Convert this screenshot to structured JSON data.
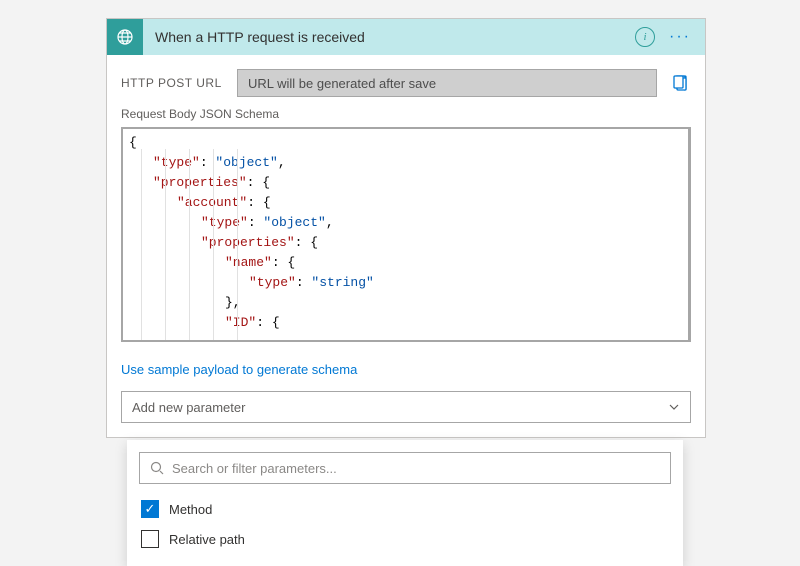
{
  "header": {
    "title": "When a HTTP request is received",
    "info_aria": "Info",
    "menu_aria": "More options"
  },
  "url": {
    "label": "HTTP POST URL",
    "value": "URL will be generated after save",
    "copy_aria": "Copy URL"
  },
  "schema": {
    "label": "Request Body JSON Schema",
    "lines": [
      {
        "indent": 0,
        "open": "{"
      },
      {
        "indent": 1,
        "key": "type",
        "val": "object",
        "comma": true
      },
      {
        "indent": 1,
        "key": "properties",
        "open": "{"
      },
      {
        "indent": 2,
        "key": "account",
        "open": "{"
      },
      {
        "indent": 3,
        "key": "type",
        "val": "object",
        "comma": true
      },
      {
        "indent": 3,
        "key": "properties",
        "open": "{"
      },
      {
        "indent": 4,
        "key": "name",
        "open": "{"
      },
      {
        "indent": 5,
        "key": "type",
        "val": "string"
      },
      {
        "indent": 4,
        "close": "},"
      },
      {
        "indent": 4,
        "key": "ID",
        "open": "{",
        "truncated": true
      }
    ]
  },
  "sample_link": "Use sample payload to generate schema",
  "add_param": {
    "placeholder": "Add new parameter"
  },
  "dropdown": {
    "search_placeholder": "Search or filter parameters...",
    "options": [
      {
        "label": "Method",
        "checked": true
      },
      {
        "label": "Relative path",
        "checked": false
      }
    ]
  }
}
